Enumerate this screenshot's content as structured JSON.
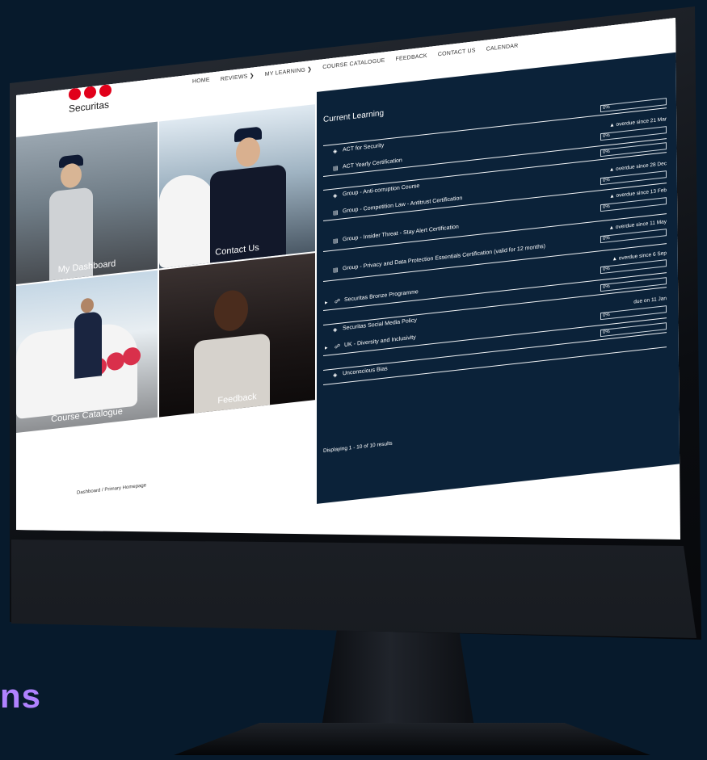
{
  "topbar": {
    "icons": [
      "home-icon",
      "minus-icon",
      "tablet-icon",
      "search-icon",
      "user-circle-icon",
      "envelope-icon",
      "bell-icon"
    ]
  },
  "logo": {
    "text": "Securitas",
    "brand_color": "#e1001a"
  },
  "nav": {
    "items": [
      {
        "label": "HOME"
      },
      {
        "label": "REVIEWS ❯"
      },
      {
        "label": "MY LEARNING ❯"
      },
      {
        "label": "COURSE CATALOGUE"
      },
      {
        "label": "FEEDBACK"
      },
      {
        "label": "CONTACT US"
      },
      {
        "label": "CALENDAR"
      }
    ]
  },
  "tiles": {
    "dashboard": "My Dashboard",
    "contact": "Contact Us",
    "catalogue": "Course Catalogue",
    "feedback": "Feedback"
  },
  "learning": {
    "title": "Current Learning",
    "rows": [
      {
        "name": "ACT for Security",
        "icon": "shield-icon",
        "due": "",
        "progress": "0%",
        "expander": false
      },
      {
        "name": "ACT Yearly Certification",
        "icon": "document-icon",
        "due": "▲ overdue since 21 Mar",
        "progress": "0%",
        "expander": false
      },
      {
        "name": "Group - Anti-corruption Course",
        "icon": "shield-icon",
        "due": "",
        "progress": "0%",
        "expander": false
      },
      {
        "name": "Group - Competition Law - Antitrust Certification",
        "icon": "document-icon",
        "due": "▲ overdue since 28 Dec",
        "progress": "0%",
        "expander": false
      },
      {
        "name": "Group - Insider Threat - Stay Alert Certification",
        "icon": "document-icon",
        "due": "▲ overdue since 13 Feb",
        "progress": "0%",
        "expander": false
      },
      {
        "name": "Group - Privacy and Data Protection Essentials Certification (valid for 12 months)",
        "icon": "document-icon",
        "due": "▲ overdue since 11 May",
        "progress": "0%",
        "expander": false
      },
      {
        "name": "Securitas Bronze Programme",
        "icon": "users-icon",
        "due": "▲ overdue since 6 Sep",
        "progress": "0%",
        "expander": true
      },
      {
        "name": "Securitas Social Media Policy",
        "icon": "shield-icon",
        "due": "",
        "progress": "0%",
        "expander": false
      },
      {
        "name": "UK - Diversity and Inclusivity",
        "icon": "users-icon",
        "due": "due on 11 Jan",
        "progress": "0%",
        "expander": true
      },
      {
        "name": "Unconscious Bias",
        "icon": "shield-icon",
        "due": "",
        "progress": "0%",
        "expander": false
      }
    ],
    "results": "Displaying 1 - 10 of 10 results"
  },
  "breadcrumb": "Dashboard / Primary Homepage",
  "tagline": "ns"
}
